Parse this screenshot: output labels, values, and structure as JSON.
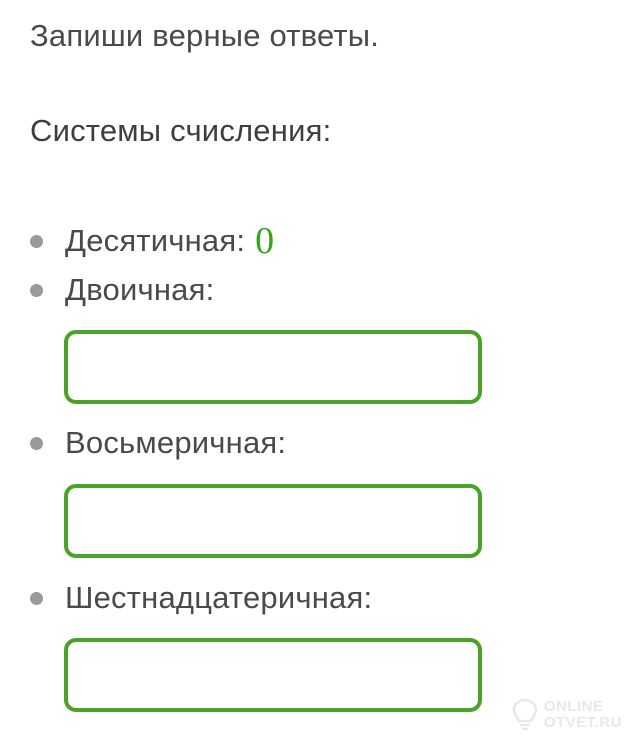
{
  "instruction": "Запиши верные ответы.",
  "heading": "Системы счисления:",
  "items": [
    {
      "label": "Десятичная:",
      "answer": "0"
    },
    {
      "label": "Двоичная:",
      "input_value": ""
    },
    {
      "label": "Восьмеричная:",
      "input_value": ""
    },
    {
      "label": "Шестнадцатеричная:",
      "input_value": ""
    }
  ],
  "watermark": {
    "line1": "ONLINE",
    "line2": "OTVET.RU"
  },
  "colors": {
    "accent": "#4aa326",
    "answer": "#3aa31a",
    "bullet": "#9a9a9a"
  }
}
